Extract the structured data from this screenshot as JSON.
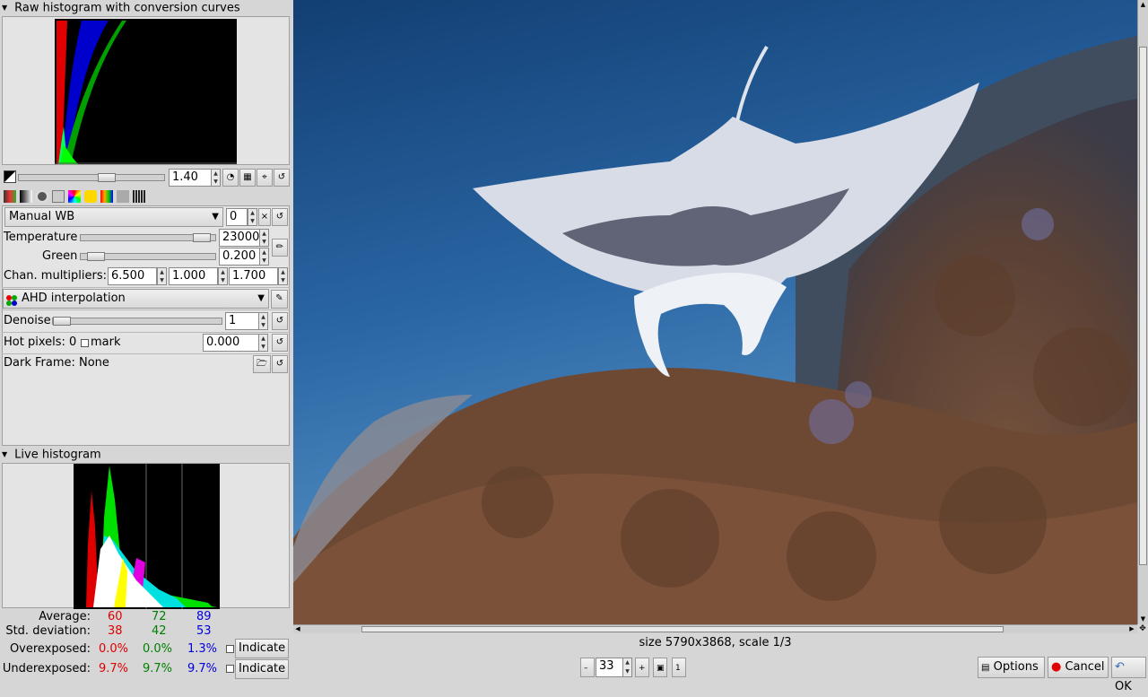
{
  "raw_histogram": {
    "title": "Raw histogram with conversion curves",
    "exposure_value": "1.40"
  },
  "white_balance": {
    "preset": "Manual WB",
    "fine_tune": "0",
    "temperature_label": "Temperature",
    "temperature_value": "23000",
    "temperature_level": 0.95,
    "green_label": "Green",
    "green_value": "0.200",
    "green_level": 0.05,
    "chan_label": "Chan. multipliers:",
    "chan_values": [
      "6.500",
      "1.000",
      "1.700"
    ]
  },
  "interpolation": {
    "value": "AHD interpolation"
  },
  "denoise": {
    "label": "Denoise",
    "value": "1"
  },
  "hot_pixels": {
    "label": "Hot pixels: 0",
    "mark_label": "mark",
    "value": "0.000"
  },
  "dark_frame": {
    "label": "Dark Frame: None"
  },
  "live_histogram": {
    "title": "Live histogram",
    "average_label": "Average:",
    "average": [
      "60",
      "72",
      "89"
    ],
    "std_label": "Std. deviation:",
    "std": [
      "38",
      "42",
      "53"
    ],
    "over_label": "Overexposed:",
    "over": [
      "0.0%",
      "0.0%",
      "1.3%"
    ],
    "under_label": "Underexposed:",
    "under": [
      "9.7%",
      "9.7%",
      "9.7%"
    ],
    "indicate_label": "Indicate"
  },
  "image_info": "size 5790x3868, scale 1/3",
  "zoom_value": "33",
  "buttons": {
    "options": "Options",
    "cancel": "Cancel",
    "ok": "OK"
  },
  "colors": {
    "red": "#e00000",
    "green": "#008000",
    "blue": "#0000dd",
    "water_top": "#134377",
    "water_bottom": "#3a7cb8",
    "coral": "#6b4a35"
  }
}
